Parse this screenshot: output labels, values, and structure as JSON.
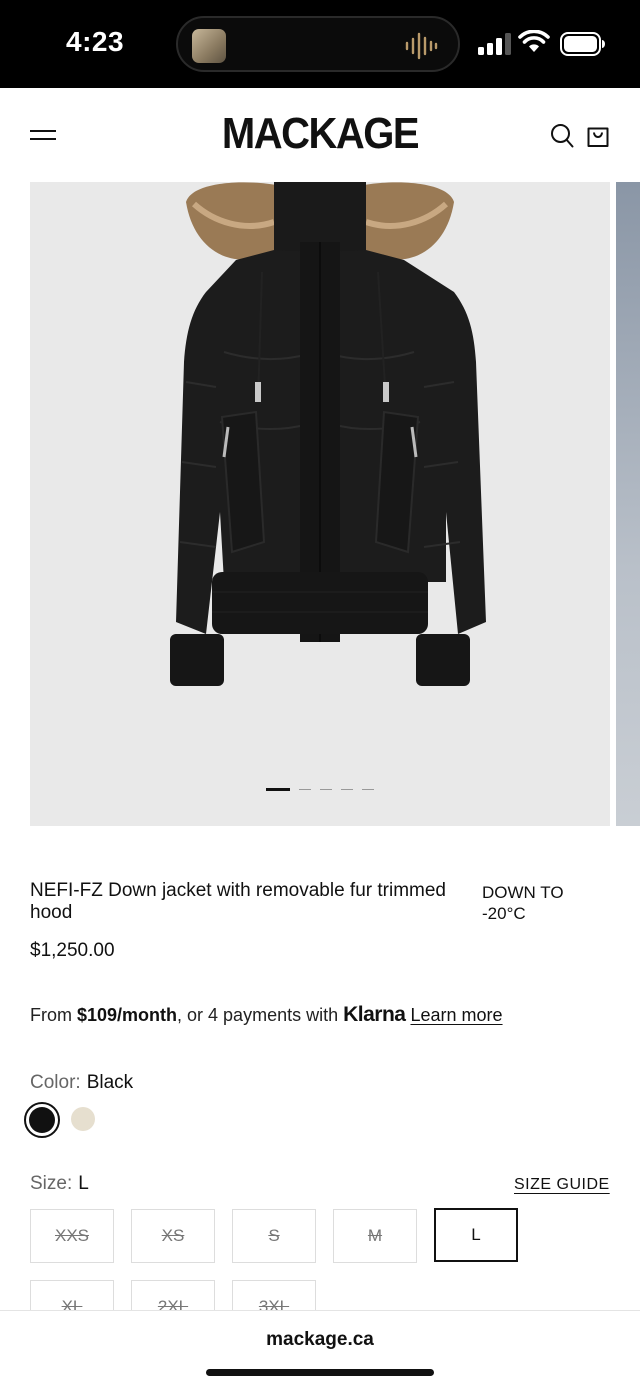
{
  "status": {
    "time": "4:23"
  },
  "header": {
    "brand": "MACKAGE"
  },
  "gallery": {
    "slide_count": 5,
    "active_slide": 1
  },
  "product": {
    "title": "NEFI-FZ Down jacket with removable fur trimmed hood",
    "temperature_line1": "DOWN TO",
    "temperature_line2": "-20°C",
    "price": "$1,250.00"
  },
  "klarna": {
    "prefix": "From ",
    "monthly": "$109/month",
    "middle": ", or 4 payments with ",
    "brand": "Klarna",
    "link": "Learn more"
  },
  "color": {
    "label": "Color:",
    "value": "Black",
    "swatches": [
      {
        "name": "Black",
        "hex": "#111111",
        "selected": true
      },
      {
        "name": "Cream",
        "hex": "#e6dfcf",
        "selected": false
      }
    ]
  },
  "size": {
    "label": "Size:",
    "value": "L",
    "guide": "SIZE GUIDE",
    "options": [
      {
        "label": "XXS",
        "available": false
      },
      {
        "label": "XS",
        "available": false
      },
      {
        "label": "S",
        "available": false
      },
      {
        "label": "M",
        "available": false
      },
      {
        "label": "L",
        "available": true,
        "selected": true
      },
      {
        "label": "XL",
        "available": false
      },
      {
        "label": "2XL",
        "available": false
      },
      {
        "label": "3XL",
        "available": false
      }
    ]
  },
  "browser": {
    "url": "mackage.ca"
  }
}
